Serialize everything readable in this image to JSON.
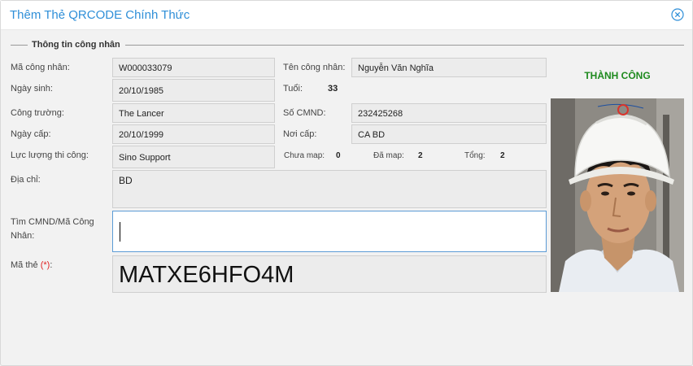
{
  "window": {
    "title": "Thêm Thẻ QRCODE Chính Thức"
  },
  "section": {
    "legend": "Thông tin công nhân"
  },
  "worker": {
    "code_label": "Mã công nhân:",
    "code": "W000033079",
    "name_label": "Tên công nhân:",
    "name": "Nguyễn Văn Nghĩa",
    "dob_label": "Ngày sinh:",
    "dob": "20/10/1985",
    "age_label": "Tuổi:",
    "age": "33",
    "site_label": "Công trường:",
    "site": "The Lancer",
    "id_label": "Số CMND:",
    "id_number": "232425268",
    "issue_date_label": "Ngày cấp:",
    "issue_date": "20/10/1999",
    "issue_place_label": "Nơi cấp:",
    "issue_place": "CA BD",
    "force_label": "Lực lượng thi công:",
    "force": "Sino Support",
    "unmapped_label": "Chưa map:",
    "unmapped": "0",
    "mapped_label": "Đã map:",
    "mapped": "2",
    "total_label": "Tổng:",
    "total": "2",
    "address_label": "Địa chỉ:",
    "address": "BD"
  },
  "search": {
    "label_line1": "Tìm CMND/Mã Công",
    "label_line2": "Nhân:",
    "value": ""
  },
  "card": {
    "label": "Mã thẻ",
    "required_mark": "(*)",
    "label_suffix": ":",
    "code": "MATXE6HFO4M"
  },
  "status": {
    "text": "THÀNH CÔNG",
    "color": "#1e8a1e"
  },
  "icons": {
    "close": "close-circle-icon",
    "photo": "worker-photo"
  },
  "colors": {
    "title": "#2f8fd8",
    "search_border": "#5b9bd5"
  }
}
